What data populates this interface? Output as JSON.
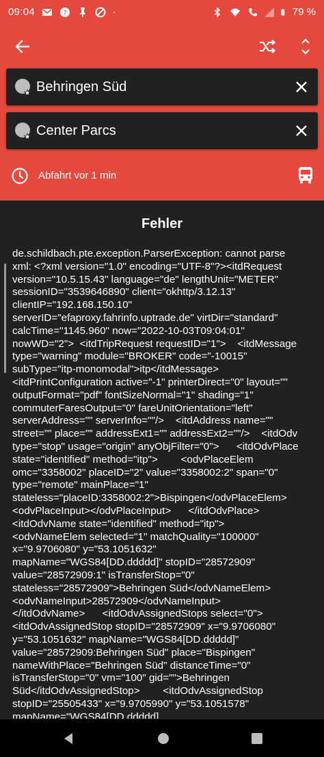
{
  "status_bar": {
    "time": "09:04",
    "battery": "79 %"
  },
  "trip": {
    "from": "Behringen Süd",
    "to": "Center Parcs",
    "departure": "Abfahrt vor 1 min"
  },
  "error": {
    "title": "Fehler",
    "message": "de.schildbach.pte.exception.ParserException: cannot parse xml: <?xml version=\"1.0\" encoding=\"UTF-8\"?><itdRequest version=\"10.5.15.43\" language=\"de\" lengthUnit=\"METER\" sessionID=\"3539646890\" client=\"okhttp/3.12.13\" clientIP=\"192.168.150.10\" serverID=\"efaproxy.fahrinfo.uptrade.de\" virtDir=\"standard\" calcTime=\"1145.960\" now=\"2022-10-03T09:04:01\" nowWD=\"2\">  <itdTripRequest requestID=\"1\">    <itdMessage type=\"warning\" module=\"BROKER\" code=\"-10015\" subType=\"itp-monomodal\">itp</itdMessage>    <itdPrintConfiguration active=\"-1\" printerDirect=\"0\" layout=\"\" outputFormat=\"pdf\" fontSizeNormal=\"1\" shading=\"1\" commuterFaresOutput=\"0\" fareUnitOrientation=\"left\" serverAddress=\"\" serverInfo=\"\"/>    <itdAddress name=\"\" street=\"\" place=\"\" addressExt1=\"\" addressExt2=\"\"/>    <itdOdv type=\"stop\" usage=\"origin\" anyObjFilter=\"0\">      <itdOdvPlace state=\"identified\" method=\"itp\">        <odvPlaceElem omc=\"3358002\" placeID=\"2\" value=\"3358002:2\" span=\"0\" type=\"remote\" mainPlace=\"1\" stateless=\"placeID:3358002:2\">Bispingen</odvPlaceElem>        <odvPlaceInput></odvPlaceInput>      </itdOdvPlace>      <itdOdvName state=\"identified\" method=\"itp\">        <odvNameElem selected=\"1\" matchQuality=\"100000\" x=\"9.9706080\" y=\"53.1051632\" mapName=\"WGS84[DD.ddddd]\" stopID=\"28572909\" value=\"28572909:1\" isTransferStop=\"0\" stateless=\"28572909\">Behringen Süd</odvNameElem>        <odvNameInput>28572909</odvNameInput>      </itdOdvName>      <itdOdvAssignedStops select=\"0\">        <itdOdvAssignedStop stopID=\"28572909\" x=\"9.9706080\" y=\"53.1051632\" mapName=\"WGS84[DD.ddddd]\" value=\"28572909:Behringen Süd\" place=\"Bispingen\" nameWithPlace=\"Behringen Süd\" distanceTime=\"0\" isTransferStop=\"0\" vm=\"100\" gid=\"\">Behringen Süd</itdOdvAssignedStop>        <itdOdvAssignedStop stopID=\"25505433\" x=\"9.9705990\" y=\"53.1051578\" mapName=\"WGS84[DD.ddddd]"
  },
  "icons": {
    "back": "arrow-left-icon",
    "shuffle": "shuffle-icon",
    "expand": "unfold-more-icon",
    "location": "location-marker-icon",
    "clear": "close-icon",
    "clock": "clock-icon",
    "bus": "bus-icon"
  },
  "colors": {
    "accent": "#E5483C",
    "background": "#212121",
    "field": "#212121",
    "navbar": "#000000"
  }
}
